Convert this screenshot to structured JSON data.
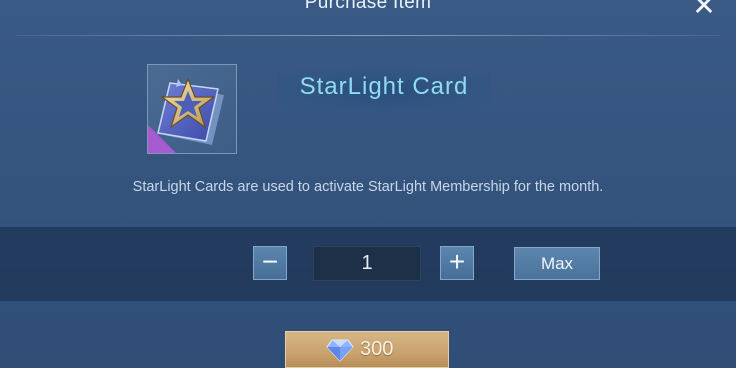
{
  "dialog": {
    "title": "Purchase Item",
    "close_icon": "close-x-icon"
  },
  "item": {
    "name": "StarLight Card",
    "icon": "starlight-card-icon",
    "description": "StarLight Cards are used to activate StarLight Membership for the month."
  },
  "quantity": {
    "value": "1",
    "minus_label": "−",
    "plus_label": "+",
    "max_label": "Max"
  },
  "purchase": {
    "price": "300",
    "currency_icon": "diamond-icon"
  },
  "colors": {
    "background": "#35557f",
    "item_name": "#8fdcf0",
    "price_button": "#c9a26d"
  }
}
